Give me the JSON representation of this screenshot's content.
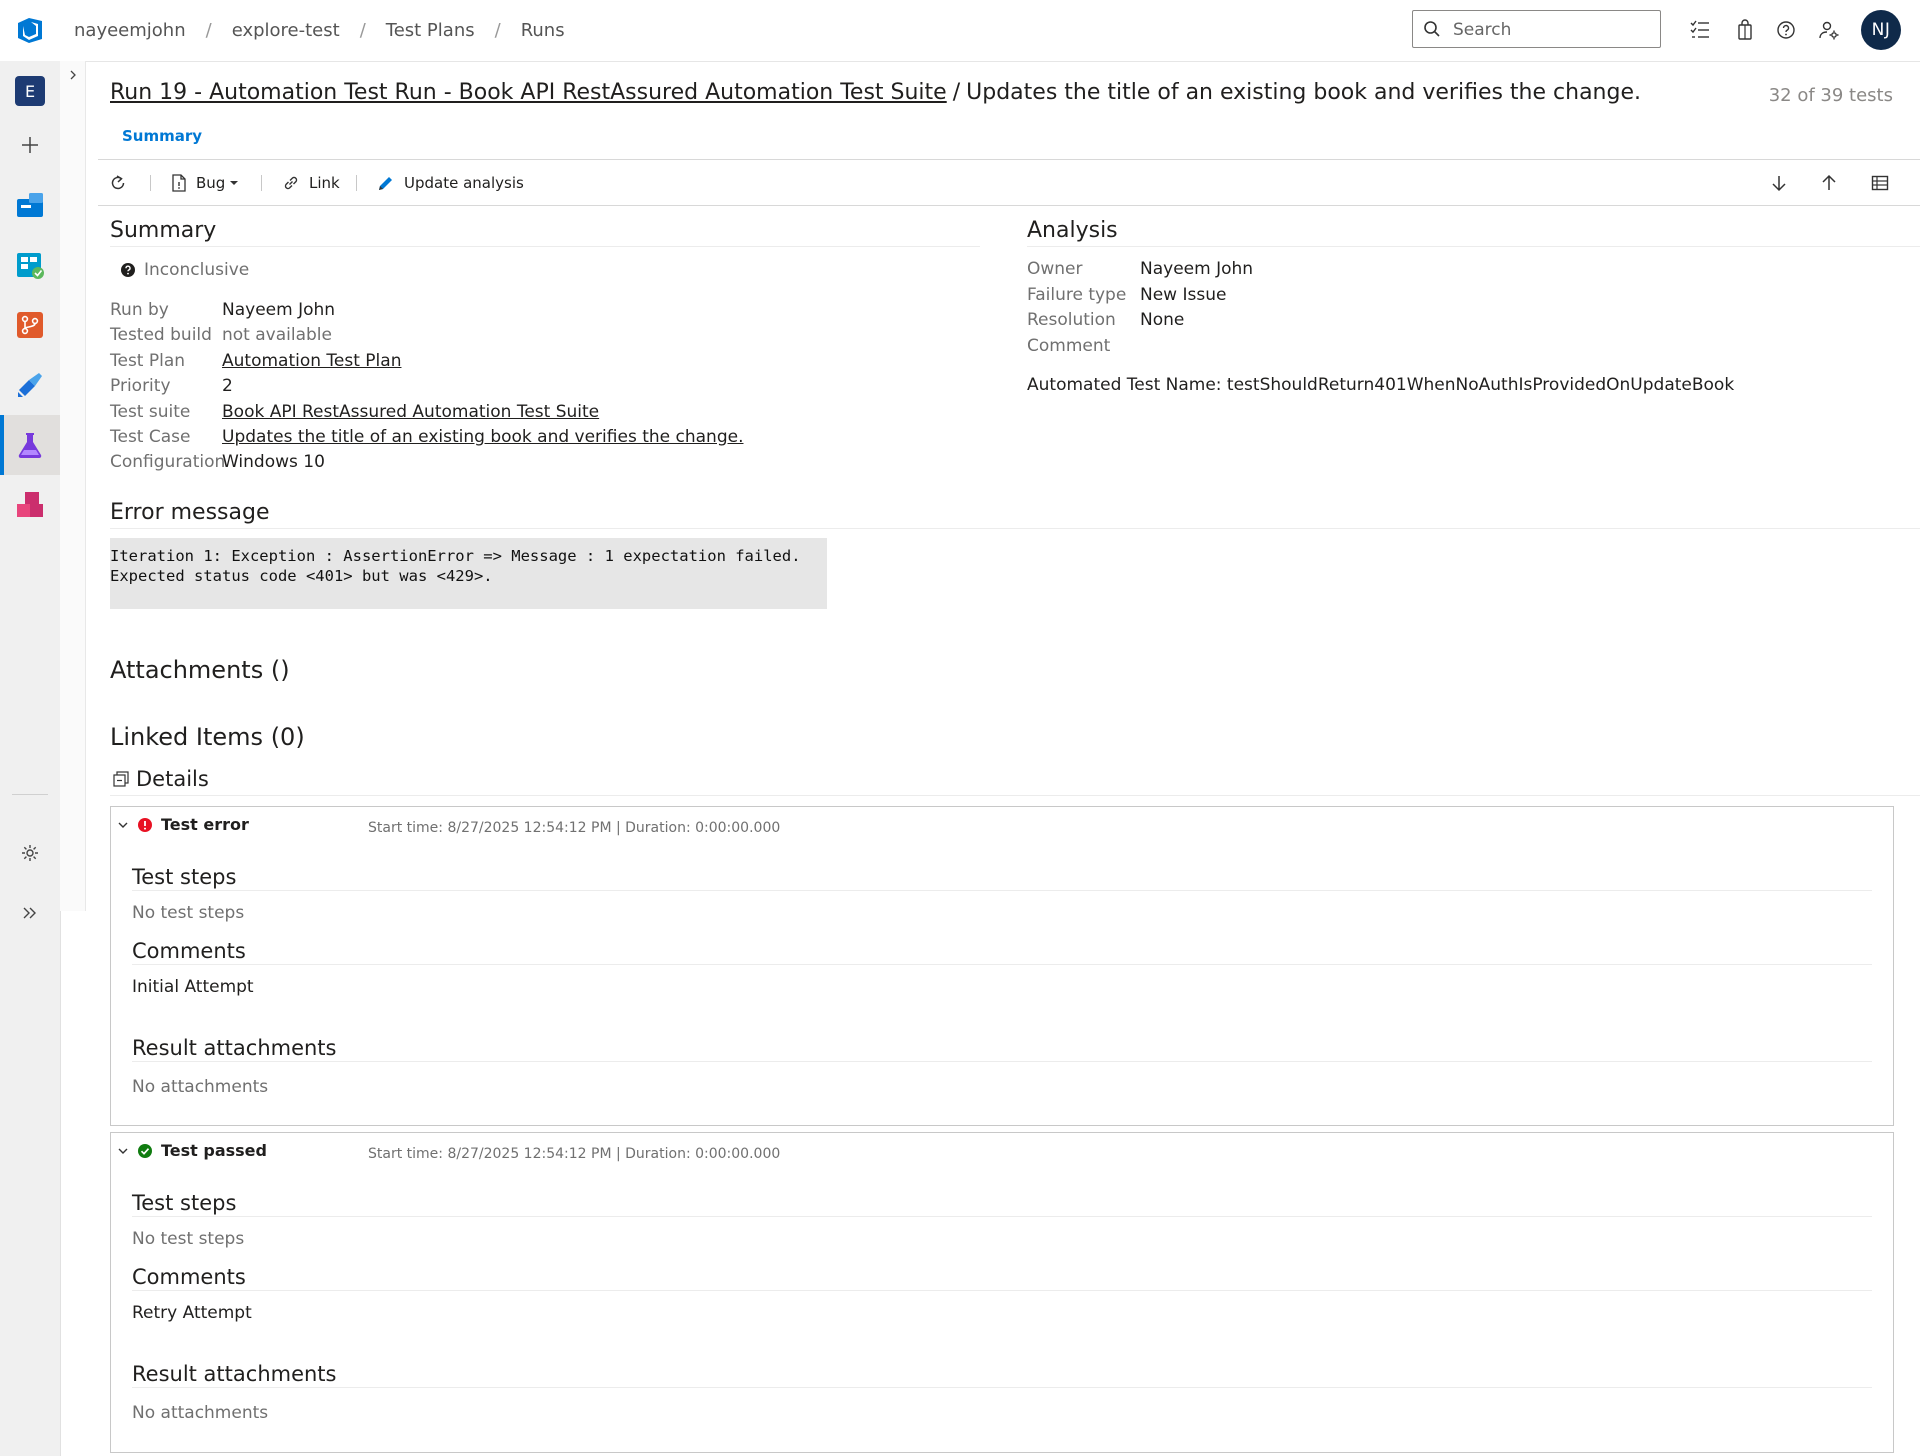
{
  "breadcrumb": [
    "nayeemjohn",
    "explore-test",
    "Test Plans",
    "Runs"
  ],
  "search": {
    "placeholder": "Search"
  },
  "user": {
    "initials": "NJ"
  },
  "nav": {
    "project_initial": "E"
  },
  "header": {
    "run_title": "Run 19 - Automation Test Run - Book API RestAssured Automation Test Suite",
    "separator": "/",
    "test_title": "Updates the title of an existing book and verifies the change.",
    "count": "32 of 39 tests"
  },
  "tabs": {
    "summary": "Summary"
  },
  "toolbar": {
    "bug": "Bug",
    "link": "Link",
    "update_analysis": "Update analysis"
  },
  "summary": {
    "title": "Summary",
    "outcome": "Inconclusive",
    "fields": [
      {
        "label": "Run by",
        "value": "Nayeem John"
      },
      {
        "label": "Tested build",
        "value": "not available"
      },
      {
        "label": "Test Plan",
        "value": "Automation Test Plan"
      },
      {
        "label": "Priority",
        "value": "2"
      },
      {
        "label": "Test suite",
        "value": "Book API RestAssured Automation Test Suite"
      },
      {
        "label": "Test Case",
        "value": "Updates the title of an existing book and verifies the change."
      },
      {
        "label": "Configuration",
        "value": "Windows 10"
      }
    ]
  },
  "analysis": {
    "title": "Analysis",
    "fields": [
      {
        "label": "Owner",
        "value": "Nayeem John"
      },
      {
        "label": "Failure type",
        "value": "New Issue"
      },
      {
        "label": "Resolution",
        "value": "None"
      },
      {
        "label": "Comment",
        "value": ""
      }
    ],
    "automated_test_name": "Automated Test Name: testShouldReturn401WhenNoAuthIsProvidedOnUpdateBook"
  },
  "error": {
    "title": "Error message",
    "line1": "Iteration 1: Exception : AssertionError => Message : 1 expectation failed.",
    "line2": "Expected status code <401> but was <429>."
  },
  "attachments": {
    "title": "Attachments ()"
  },
  "linked_items": {
    "title": "Linked Items (0)"
  },
  "details": {
    "title": "Details"
  },
  "results": [
    {
      "status": "Test error",
      "time": "Start time: 8/27/2025 12:54:12 PM | Duration: 0:00:00.000",
      "steps_title": "Test steps",
      "steps_text": "No test steps",
      "comments_title": "Comments",
      "comments_text": "Initial Attempt",
      "attach_title": "Result attachments",
      "attach_text": "No attachments",
      "color": "#e81123"
    },
    {
      "status": "Test passed",
      "time": "Start time: 8/27/2025 12:54:12 PM | Duration: 0:00:00.000",
      "steps_title": "Test steps",
      "steps_text": "No test steps",
      "comments_title": "Comments",
      "comments_text": "Retry Attempt",
      "attach_title": "Result attachments",
      "attach_text": "No attachments",
      "color": "#107c10"
    }
  ]
}
